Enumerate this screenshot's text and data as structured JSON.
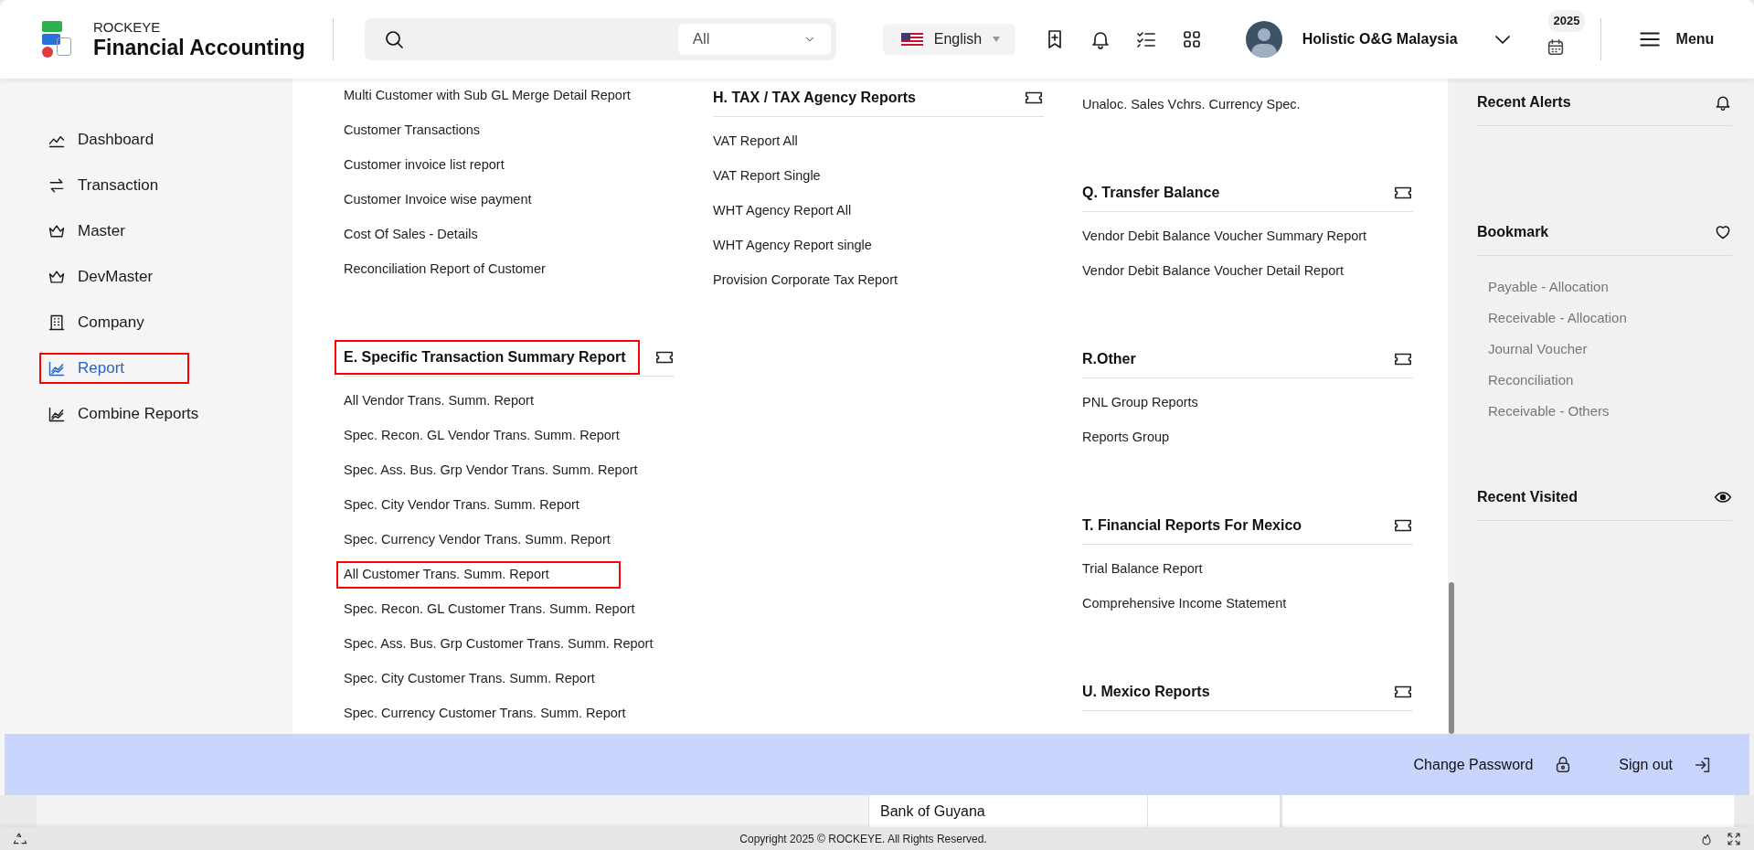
{
  "header": {
    "brand_top": "ROCKEYE",
    "brand": "Financial Accounting",
    "search": {
      "scope": "All"
    },
    "language": "English",
    "company": "Holistic O&G Malaysia",
    "year": "2025",
    "menu": "Menu"
  },
  "sidebar": [
    {
      "kind": "dashboard",
      "label": "Dashboard",
      "selected": false,
      "highlighted": false
    },
    {
      "kind": "transaction",
      "label": "Transaction",
      "selected": false,
      "highlighted": false
    },
    {
      "kind": "master",
      "label": "Master",
      "selected": false,
      "highlighted": false
    },
    {
      "kind": "master",
      "label": "DevMaster",
      "selected": false,
      "highlighted": false
    },
    {
      "kind": "company",
      "label": "Company",
      "selected": false,
      "highlighted": false
    },
    {
      "kind": "report",
      "label": "Report",
      "selected": true,
      "highlighted": true
    },
    {
      "kind": "report",
      "label": "Combine Reports",
      "selected": false,
      "highlighted": false
    }
  ],
  "report_columns": [
    [
      {
        "kind": "link",
        "label": "Multi Customer with Sub GL Merge Detail Report",
        "highlighted": false
      },
      {
        "kind": "link",
        "label": "Customer Transactions",
        "highlighted": false
      },
      {
        "kind": "link",
        "label": "Customer invoice list report",
        "highlighted": false
      },
      {
        "kind": "link",
        "label": "Customer Invoice wise payment",
        "highlighted": false
      },
      {
        "kind": "link",
        "label": "Cost Of Sales - Details",
        "highlighted": false
      },
      {
        "kind": "link",
        "label": "Reconciliation Report of Customer",
        "highlighted": false
      },
      {
        "kind": "section",
        "label": "E. Specific Transaction Summary Report",
        "highlighted": true
      },
      {
        "kind": "link",
        "label": "All Vendor Trans. Summ. Report",
        "highlighted": false
      },
      {
        "kind": "link",
        "label": "Spec. Recon. GL Vendor Trans. Summ. Report",
        "highlighted": false
      },
      {
        "kind": "link",
        "label": "Spec. Ass. Bus. Grp Vendor Trans. Summ. Report",
        "highlighted": false
      },
      {
        "kind": "link",
        "label": "Spec. City Vendor Trans. Summ. Report",
        "highlighted": false
      },
      {
        "kind": "link",
        "label": "Spec. Currency Vendor Trans. Summ. Report",
        "highlighted": false
      },
      {
        "kind": "link",
        "label": "All Customer Trans. Summ. Report",
        "highlighted": true
      },
      {
        "kind": "link",
        "label": "Spec. Recon. GL Customer Trans. Summ. Report",
        "highlighted": false
      },
      {
        "kind": "link",
        "label": "Spec. Ass. Bus. Grp Customer Trans. Summ. Report",
        "highlighted": false
      },
      {
        "kind": "link",
        "label": "Spec. City Customer Trans. Summ. Report",
        "highlighted": false
      },
      {
        "kind": "link",
        "label": "Spec. Currency Customer Trans. Summ. Report",
        "highlighted": false
      }
    ],
    [
      {
        "kind": "section",
        "label": "H. TAX / TAX Agency Reports",
        "highlighted": false
      },
      {
        "kind": "link",
        "label": "VAT Report All",
        "highlighted": false
      },
      {
        "kind": "link",
        "label": "VAT Report Single",
        "highlighted": false
      },
      {
        "kind": "link",
        "label": "WHT Agency Report All",
        "highlighted": false
      },
      {
        "kind": "link",
        "label": "WHT Agency Report single",
        "highlighted": false
      },
      {
        "kind": "link",
        "label": "Provision Corporate Tax Report",
        "highlighted": false
      }
    ],
    [
      {
        "kind": "link",
        "label": "Unaloc. Sales Vchrs. Currency Spec.",
        "highlighted": false
      },
      {
        "kind": "section",
        "label": "Q. Transfer Balance",
        "highlighted": false
      },
      {
        "kind": "link",
        "label": "Vendor Debit Balance Voucher Summary Report",
        "highlighted": false
      },
      {
        "kind": "link",
        "label": "Vendor Debit Balance Voucher Detail Report",
        "highlighted": false
      },
      {
        "kind": "section",
        "label": "R.Other",
        "highlighted": false
      },
      {
        "kind": "link",
        "label": "PNL Group Reports",
        "highlighted": false
      },
      {
        "kind": "link",
        "label": "Reports Group",
        "highlighted": false
      },
      {
        "kind": "section",
        "label": "T. Financial Reports For Mexico",
        "highlighted": false
      },
      {
        "kind": "link",
        "label": "Trial Balance Report",
        "highlighted": false
      },
      {
        "kind": "link",
        "label": "Comprehensive Income Statement",
        "highlighted": false
      },
      {
        "kind": "section",
        "label": "U. Mexico Reports",
        "highlighted": false
      }
    ]
  ],
  "right_panel": [
    {
      "kind": "alerts",
      "title": "Recent Alerts"
    },
    {
      "kind": "bookmark",
      "title": "Bookmark",
      "items": [
        "Payable - Allocation",
        "Receivable - Allocation",
        "Journal Voucher",
        "Reconciliation",
        "Receivable - Others"
      ]
    },
    {
      "kind": "visited",
      "title": "Recent Visited"
    }
  ],
  "account_bar": [
    {
      "kind": "password",
      "label": "Change Password"
    },
    {
      "kind": "signout",
      "label": "Sign out"
    }
  ],
  "background_row": {
    "cells": [
      "Bank of Guyana"
    ]
  },
  "footer": {
    "copyright": "Copyright 2025 © ROCKEYE. All Rights Reserved."
  }
}
